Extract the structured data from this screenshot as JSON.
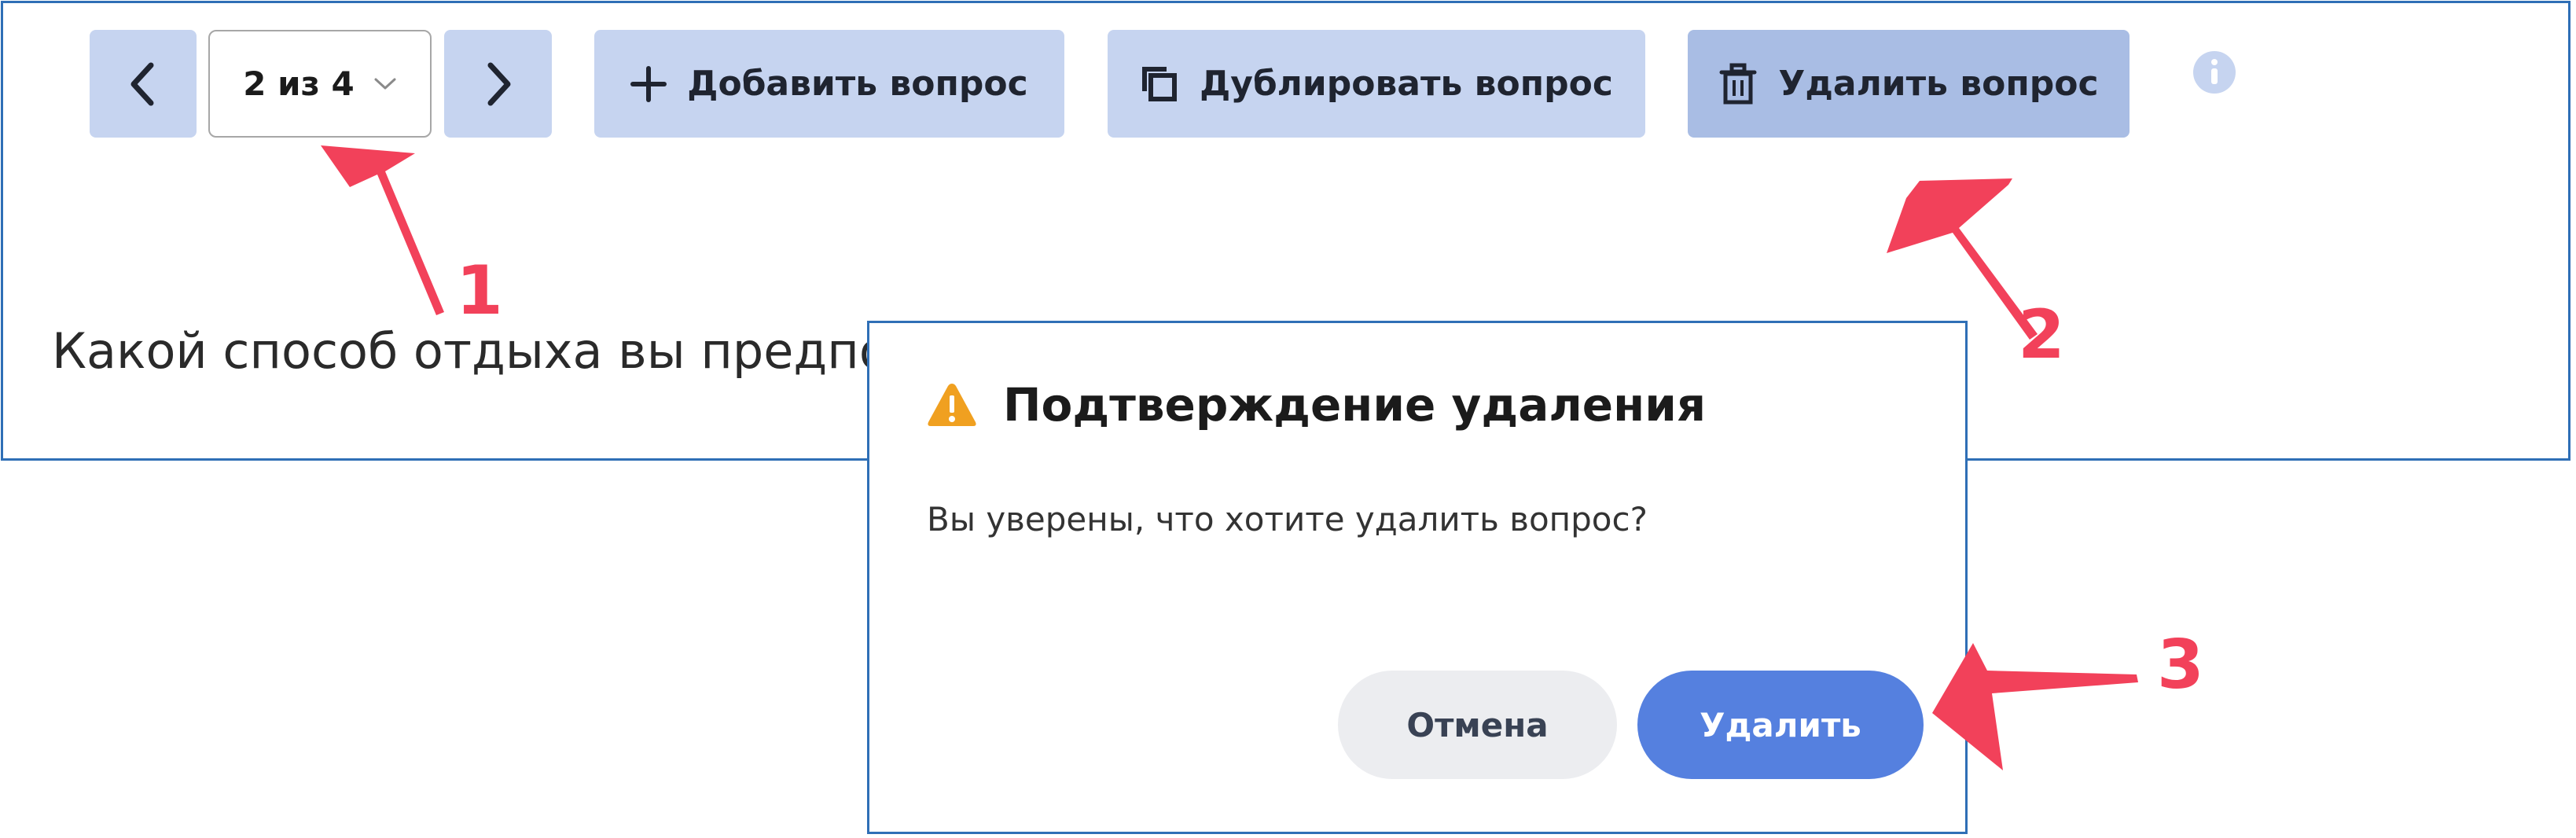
{
  "toolbar": {
    "prev_icon": "chevron-left-icon",
    "next_icon": "chevron-right-icon",
    "counter_text": "2 из 4",
    "add_label": "Добавить вопрос",
    "duplicate_label": "Дублировать вопрос",
    "delete_label": "Удалить вопрос",
    "info_icon": "info-icon"
  },
  "question": {
    "text": "Какой способ отдыха вы предпочит"
  },
  "dialog": {
    "title": "Подтверждение удаления",
    "message": "Вы уверены, что хотите удалить вопрос?",
    "cancel_label": "Отмена",
    "delete_label": "Удалить"
  },
  "callouts": [
    "1",
    "2",
    "3"
  ],
  "colors": {
    "toolbar_button": "#c6d4f0",
    "active_button": "#a9bde4",
    "primary": "#5580df",
    "frame_border": "#2f6fb6",
    "callout": "#f2415a",
    "warning": "#f0a020"
  }
}
